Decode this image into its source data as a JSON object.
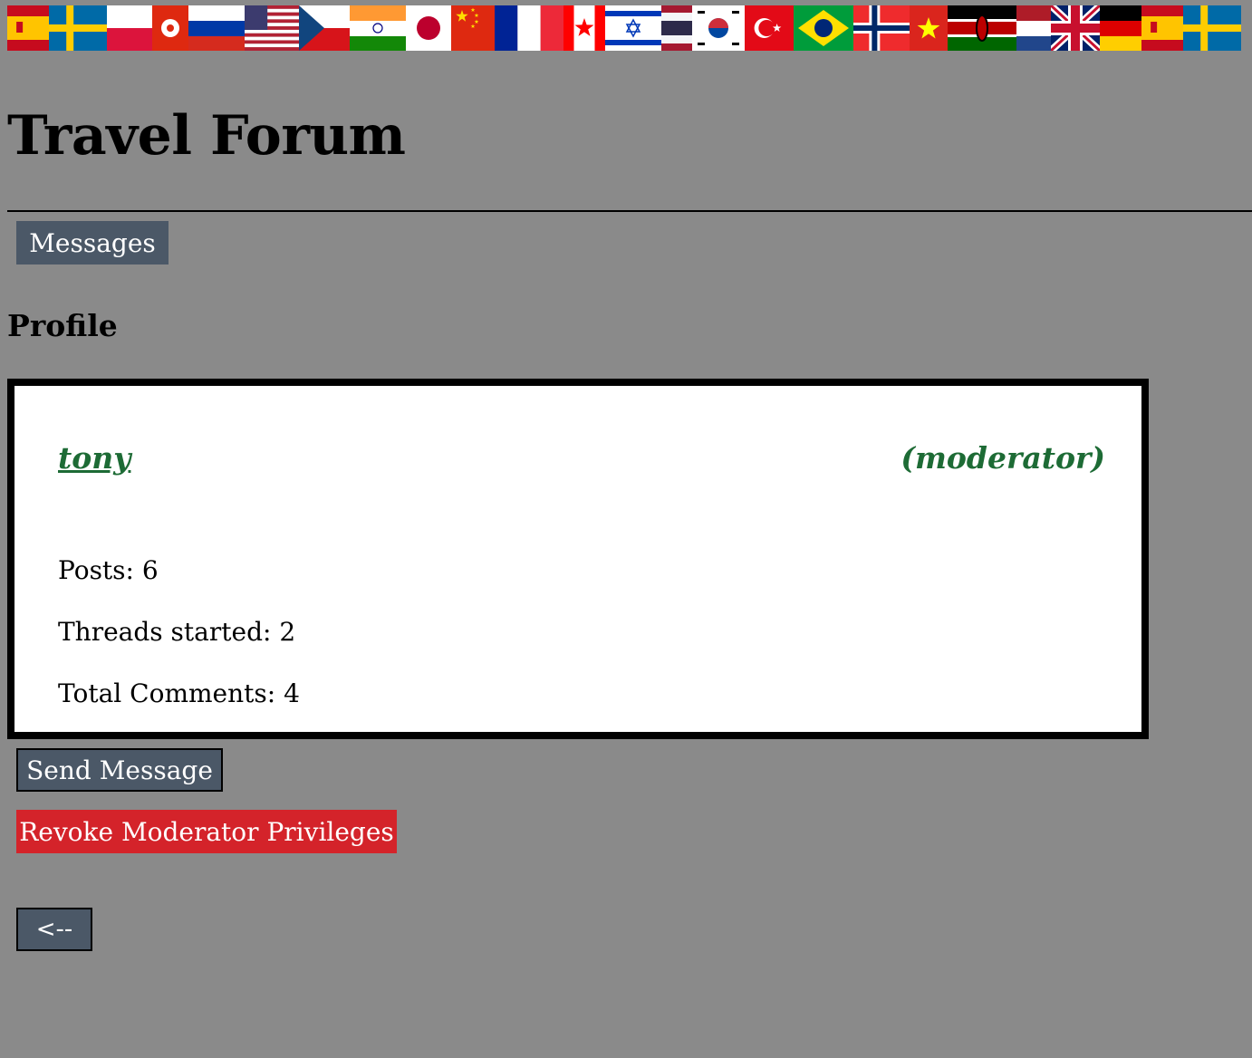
{
  "banner": {
    "flags": [
      {
        "name": "spain-flag-icon",
        "colors": [
          "#c60b1e",
          "#ffc400"
        ]
      },
      {
        "name": "sweden-flag-icon",
        "colors": [
          "#006aa7",
          "#fecc00"
        ]
      },
      {
        "name": "poland-flag-icon",
        "colors": [
          "#ffffff",
          "#dc143c"
        ]
      },
      {
        "name": "hong-kong-flag-icon",
        "colors": [
          "#de2910",
          "#ffffff"
        ]
      },
      {
        "name": "russia-flag-icon",
        "colors": [
          "#ffffff",
          "#0039a6",
          "#d52b1e"
        ]
      },
      {
        "name": "usa-flag-icon",
        "colors": [
          "#b22234",
          "#ffffff",
          "#3c3b6e"
        ]
      },
      {
        "name": "czech-flag-icon",
        "colors": [
          "#ffffff",
          "#d7141a",
          "#11457e"
        ]
      },
      {
        "name": "india-flag-icon",
        "colors": [
          "#ff9933",
          "#ffffff",
          "#138808",
          "#000080"
        ]
      },
      {
        "name": "japan-flag-icon",
        "colors": [
          "#ffffff",
          "#bc002d"
        ]
      },
      {
        "name": "china-flag-icon",
        "colors": [
          "#de2910",
          "#ffde00"
        ]
      },
      {
        "name": "france-flag-icon",
        "colors": [
          "#002395",
          "#ffffff",
          "#ed2939"
        ]
      },
      {
        "name": "canada-flag-icon",
        "colors": [
          "#ff0000",
          "#ffffff"
        ]
      },
      {
        "name": "israel-flag-icon",
        "colors": [
          "#ffffff",
          "#0038b8"
        ]
      },
      {
        "name": "thailand-flag-icon",
        "colors": [
          "#a51931",
          "#f4f5f8",
          "#2d2a4a"
        ]
      },
      {
        "name": "south-korea-flag-icon",
        "colors": [
          "#ffffff",
          "#cd2e3a",
          "#0047a0",
          "#000000"
        ]
      },
      {
        "name": "turkey-flag-icon",
        "colors": [
          "#e30a17",
          "#ffffff"
        ]
      },
      {
        "name": "brazil-flag-icon",
        "colors": [
          "#009c3b",
          "#ffdf00",
          "#002776"
        ]
      },
      {
        "name": "norway-flag-icon",
        "colors": [
          "#ef2b2d",
          "#ffffff",
          "#002868"
        ]
      },
      {
        "name": "vietnam-flag-icon",
        "colors": [
          "#da251d",
          "#ffff00"
        ]
      },
      {
        "name": "kenya-flag-icon",
        "colors": [
          "#000000",
          "#bb0000",
          "#006600",
          "#ffffff"
        ]
      },
      {
        "name": "netherlands-flag-icon",
        "colors": [
          "#ae1c28",
          "#ffffff",
          "#21468b"
        ]
      },
      {
        "name": "uk-flag-icon",
        "colors": [
          "#012169",
          "#ffffff",
          "#c8102e"
        ]
      },
      {
        "name": "germany-flag-icon",
        "colors": [
          "#000000",
          "#dd0000",
          "#ffce00"
        ]
      },
      {
        "name": "spain-flag-icon",
        "colors": [
          "#c60b1e",
          "#ffc400"
        ]
      },
      {
        "name": "sweden-flag-icon",
        "colors": [
          "#006aa7",
          "#fecc00"
        ]
      }
    ]
  },
  "header": {
    "title": "Travel Forum"
  },
  "nav": {
    "messages_label": "Messages"
  },
  "profile": {
    "section_title": "Profile",
    "username": "tony",
    "role": "(moderator)",
    "posts": "Posts: 6",
    "threads_started": "Threads started: 2",
    "total_comments": "Total Comments: 4"
  },
  "actions": {
    "send_message_label": "Send Message",
    "revoke_label": "Revoke Moderator Privileges",
    "back_label": "<--"
  },
  "colors": {
    "page_background": "#8a8a8a",
    "button_slate": "#4b5867",
    "button_red": "#d4232a",
    "username_green": "#1d6b35"
  }
}
